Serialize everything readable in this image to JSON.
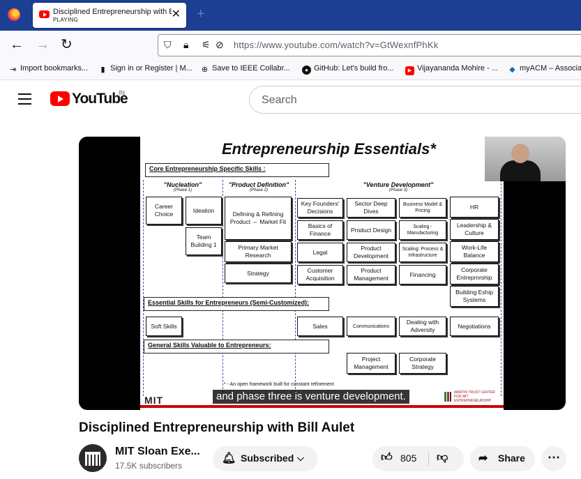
{
  "browser": {
    "tab_title": "Disciplined Entrepreneurship with Bill Aulet - YouTube",
    "tab_status": "PLAYING",
    "url": "https://www.youtube.com/watch?v=GtWexnfPhKk",
    "bookmarks": [
      {
        "label": "Import bookmarks...",
        "icon": "import-icon"
      },
      {
        "label": "Sign in or Register | M...",
        "icon": "bars-icon"
      },
      {
        "label": "Save to IEEE Collabr...",
        "icon": "globe-icon"
      },
      {
        "label": "GitHub: Let's build fro...",
        "icon": "github-icon"
      },
      {
        "label": "Vijayananda Mohire - ...",
        "icon": "youtube-icon"
      },
      {
        "label": "myACM – Associat",
        "icon": "acm-icon"
      }
    ]
  },
  "youtube": {
    "logo_text": "YouTube",
    "country": "IN",
    "search_placeholder": "Search"
  },
  "slide": {
    "title": "Entrepreneurship Essentials*",
    "sections": {
      "core": "Core Entrepreneurship Specific Skills :",
      "essential": "Essential Skills for Entrepreneurs (Semi-Customized):",
      "general": "General Skills Valuable to Entrepreneurs:"
    },
    "phases": [
      {
        "name": "\"Nucleation\"",
        "sub": "(Phase 1)"
      },
      {
        "name": "\"Product Definition\"",
        "sub": "(Phase 2)"
      },
      {
        "name": "\"Venture Development\"",
        "sub": "(Phase 3)"
      }
    ],
    "boxes": {
      "career": "Career Choice",
      "ideation": "Ideation",
      "team": "Team Building 1",
      "defining": "Defining & Refining Product ⇔ Market Fit",
      "primary": "Primary Market Research",
      "strategy": "Strategy",
      "key_founders": "Key Founders' Decisions",
      "basics_finance": "Basics of Finance",
      "legal": "Legal",
      "customer_acq": "Customer Acquisition",
      "sector": "Sector Deep Dives",
      "product_design": "Product Design",
      "product_dev": "Product Development",
      "product_mgmt": "Product Management",
      "business_model": "Business Model & Pricing",
      "scaling_mfg": "Scaling - Manufacturing",
      "scaling_process": "Scaling: Process & Infrastructure",
      "financing": "Financing",
      "hr": "HR",
      "leadership": "Leadership & Culture",
      "work_life": "Work-Life Balance",
      "corporate_entre": "Corporate Entreprnrship",
      "building_eship": "Building Eship Systems",
      "soft_skills": "Soft Skills",
      "sales": "Sales",
      "communications": "Communications",
      "dealing": "Dealing with Adversity",
      "negotiations": "Negotiations",
      "project_mgmt": "Project Management",
      "corporate_strategy": "Corporate Strategy"
    },
    "footnote": "* - An open framework built for constant refinement",
    "mit_logo": "MIT",
    "mit_center": "MARTIN TRUST CENTER FOR MIT ENTREPRENEURSHIP"
  },
  "caption": "and phase three is venture development.",
  "video": {
    "title": "Disciplined Entrepreneurship with Bill Aulet",
    "channel": "MIT Sloan Exe...",
    "subscribers": "17.5K subscribers",
    "subscribed_label": "Subscribed",
    "likes": "805",
    "share_label": "Share"
  }
}
